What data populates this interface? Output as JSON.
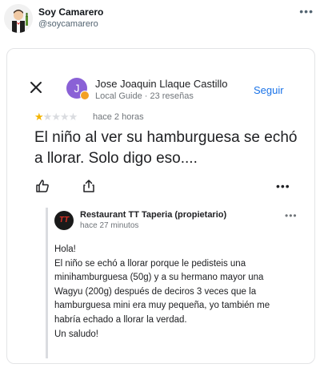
{
  "tweet": {
    "display_name": "Soy Camarero",
    "handle": "@soycamarero",
    "more_icon": "more-horizontal-icon"
  },
  "review": {
    "reviewer_initial": "J",
    "reviewer_name": "Jose Joaquin Llaque Castillo",
    "reviewer_meta": "Local Guide · 23 reseñas",
    "follow_label": "Seguir",
    "rating": 1,
    "rating_max": 5,
    "time": "hace 2 horas",
    "text": "El niño al ver su hamburguesa se echó a llorar. Solo digo eso....",
    "colors": {
      "star": "#f4b400",
      "follow": "#1a73e8",
      "avatar": "#8a61d6"
    }
  },
  "owner_response": {
    "logo_text": "TT",
    "owner_name": "Restaurant TT Taperia (propietario)",
    "time": "hace 27 minutos",
    "lines": [
      "Hola!",
      "El niño se echó a llorar porque le pedisteis una",
      "minihamburguesa (50g) y a su hermano mayor una",
      "Wagyu (200g) después de deciros 3 veces que la",
      "hamburguesa mini era muy pequeña, yo también me",
      "habría echado a llorar la verdad.",
      "Un saludo!"
    ]
  }
}
